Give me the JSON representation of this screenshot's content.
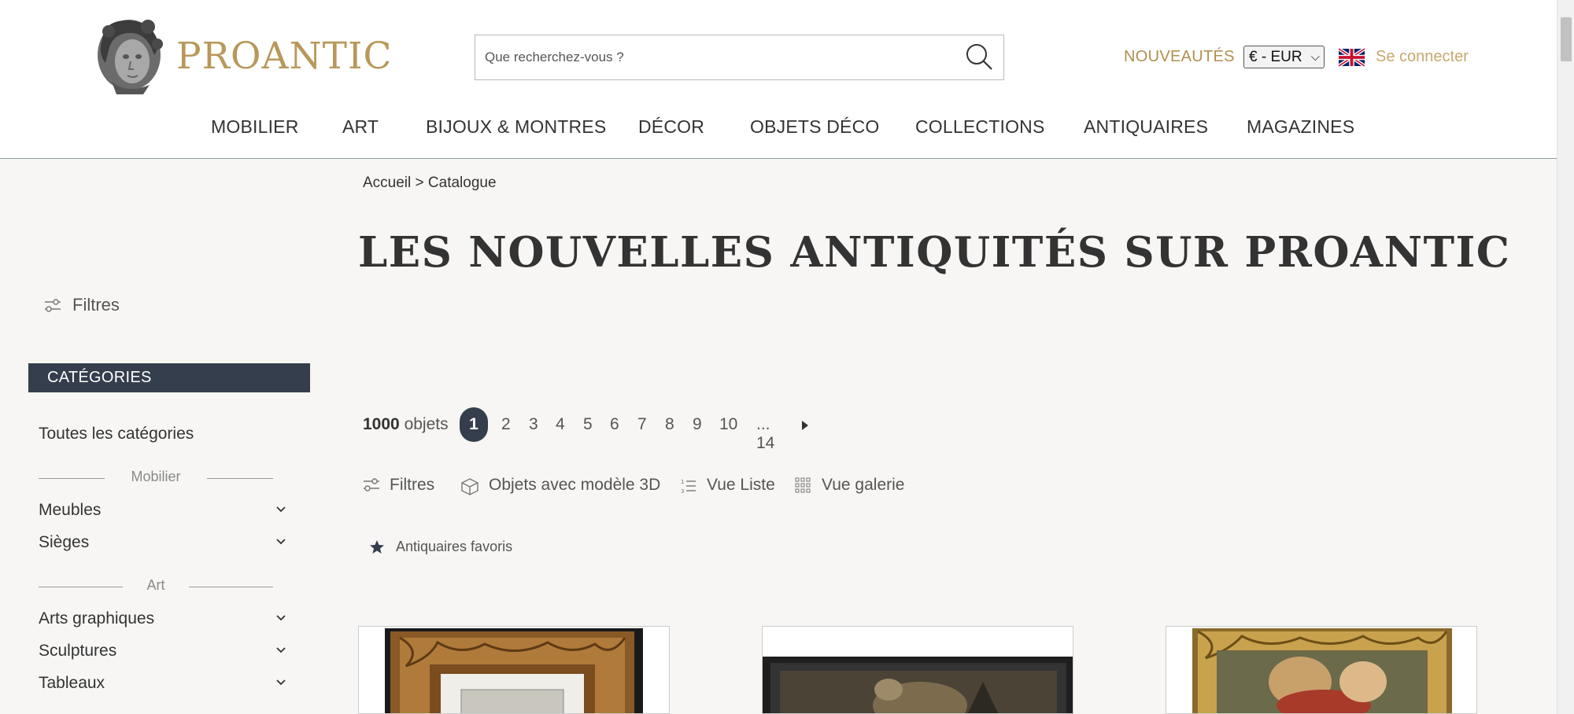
{
  "header": {
    "logo_text": "PROANTIC",
    "search_placeholder": "Que recherchez-vous ?",
    "nouveautes": "NOUVEAUTÉS",
    "currency": "€ - EUR",
    "login": "Se connecter"
  },
  "nav": [
    "MOBILIER",
    "ART",
    "BIJOUX & MONTRES",
    "DÉCOR",
    "OBJETS DÉCO",
    "COLLECTIONS",
    "ANTIQUAIRES",
    "MAGAZINES"
  ],
  "sidebar": {
    "filters_label": "Filtres",
    "categories_title": "CATÉGORIES",
    "all_categories": "Toutes les catégories",
    "groups": [
      {
        "title": "Mobilier",
        "items": [
          "Meubles",
          "Sièges"
        ]
      },
      {
        "title": "Art",
        "items": [
          "Arts graphiques",
          "Sculptures",
          "Tableaux"
        ]
      }
    ]
  },
  "main": {
    "breadcrumb": "Accueil > Catalogue",
    "title": "LES NOUVELLES ANTIQUITÉS SUR PROANTIC",
    "count_number": "1000",
    "count_label": "objets",
    "current_page": "1",
    "pages": [
      "2",
      "3",
      "4",
      "5",
      "6",
      "7",
      "8",
      "9",
      "10",
      "... 14"
    ],
    "toolbar": {
      "filters": "Filtres",
      "models3d": "Objets avec modèle 3D",
      "list_view": "Vue Liste",
      "gallery_view": "Vue galerie"
    },
    "favorites": "Antiquaires favoris"
  },
  "colors": {
    "brand_gold": "#b8985a",
    "dark_slate": "#353e4c",
    "background": "#f7f6f4"
  }
}
